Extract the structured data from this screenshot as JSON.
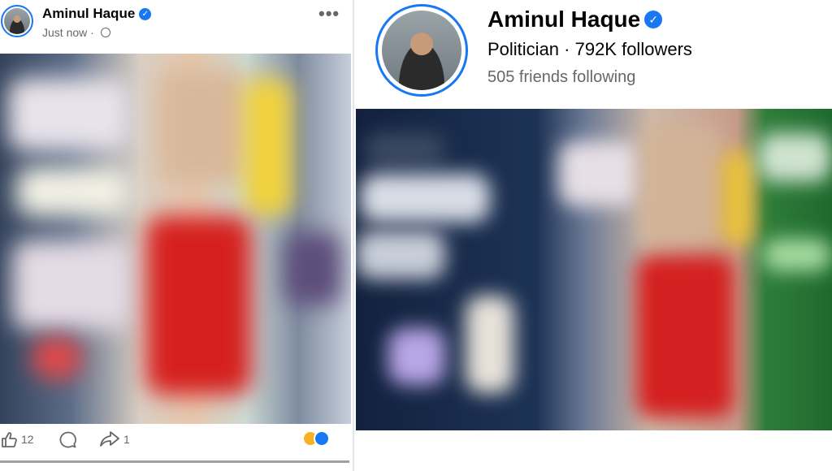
{
  "post": {
    "author": "Aminul Haque",
    "time": "Just now",
    "more_label": "•••",
    "like_count": "12",
    "share_count": "1"
  },
  "profile": {
    "name": "Aminul Haque",
    "subtitle": "Politician · 792K followers",
    "friends": "505 friends following"
  },
  "colors": {
    "accent": "#1877f2",
    "secondary_text": "#65676b"
  },
  "icons": {
    "verified": "verified-badge-icon",
    "audience": "globe-icon",
    "like": "thumbs-up-icon",
    "comment": "comment-icon",
    "share": "share-arrow-icon",
    "reactions": [
      "haha-reaction-icon",
      "like-reaction-icon"
    ]
  }
}
